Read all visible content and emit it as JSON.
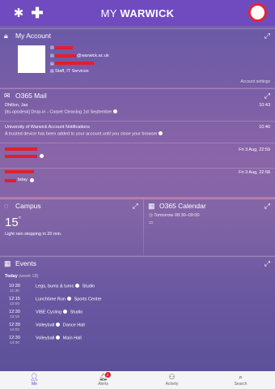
{
  "header": {
    "title_prefix": "MY",
    "title_main": "WARWICK"
  },
  "account": {
    "title": "My Account",
    "email_suffix": "@warwick.ac.uk",
    "department": "Staff, IT Services",
    "settings_link": "Account settings"
  },
  "mail": {
    "title": "O365 Mail",
    "items": [
      {
        "from": "Dhillon, Jas",
        "time": "10:43",
        "subject": "[its-opsdesk] Drop-in - Carpet Cleaning 1st September"
      },
      {
        "from": "University of Warwick Account Notifications",
        "time": "10:40",
        "subject": "A trusted device has been added to your account until you close your browser"
      },
      {
        "from": "",
        "time": "Fri 3 Aug, 22:59",
        "subject": ""
      },
      {
        "from": "",
        "time": "Fri 3 Aug, 22:58",
        "subject": "bday"
      }
    ]
  },
  "campus": {
    "title": "Campus",
    "temperature": "15",
    "unit": "°",
    "weather": "Light rain stopping in 20 min."
  },
  "calendar": {
    "title": "O365 Calendar",
    "entry": "Tomorrow 08:30–09:00"
  },
  "events": {
    "title": "Events",
    "today_label": "Today",
    "today_week": "(week 18)",
    "items": [
      {
        "start": "10:30",
        "end": "11:30",
        "name": "Legs, bums & tums",
        "place": "Studio"
      },
      {
        "start": "12:15",
        "end": "13:00",
        "name": "Lunchtime Run",
        "place": "Sports Centre"
      },
      {
        "start": "12:30",
        "end": "13:15",
        "name": "VIBE Cycling",
        "place": "Studio"
      },
      {
        "start": "12:30",
        "end": "14:00",
        "name": "Volleyball",
        "place": "Dance Hall"
      },
      {
        "start": "12:30",
        "end": "14:30",
        "name": "Volleyball",
        "place": "Main Hall"
      }
    ]
  },
  "nav": {
    "items": [
      {
        "label": "Me",
        "icon": "person-icon"
      },
      {
        "label": "Alerts",
        "icon": "bell-icon",
        "badge": "1"
      },
      {
        "label": "Activity",
        "icon": "activity-icon"
      },
      {
        "label": "Search",
        "icon": "search-icon"
      }
    ]
  },
  "colors": {
    "accent": "#6f4bbf",
    "alert": "#e0202a"
  }
}
